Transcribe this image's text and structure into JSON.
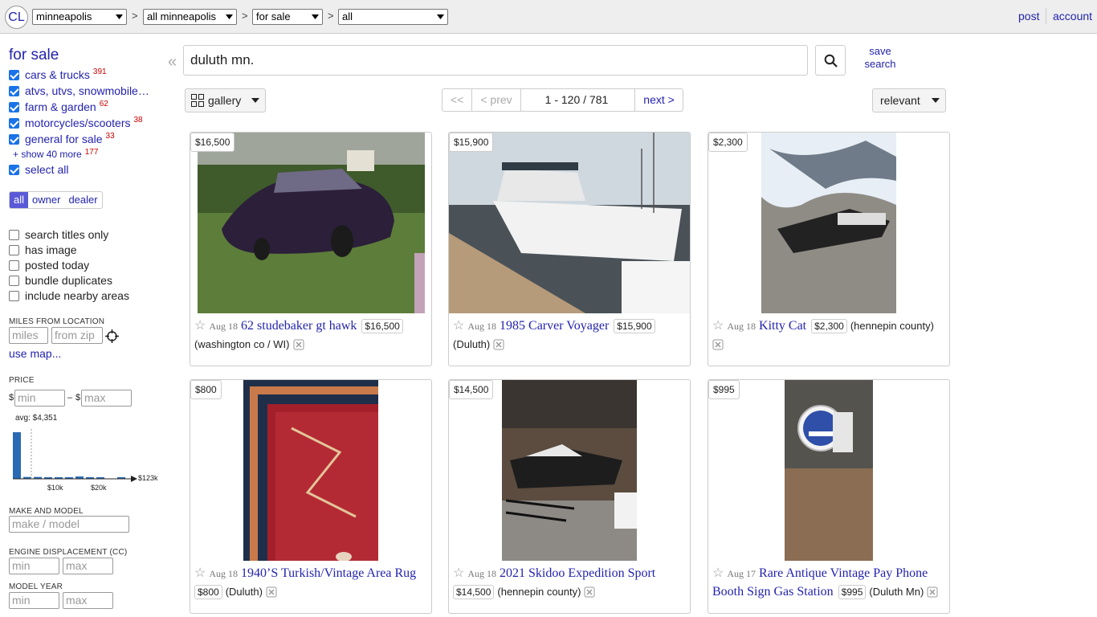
{
  "header": {
    "logo": "CL",
    "area": "minneapolis",
    "subarea": "all minneapolis",
    "category": "for sale",
    "subcategory": "all",
    "post": "post",
    "account": "account"
  },
  "sidebar": {
    "heading": "for sale",
    "categories": [
      {
        "label": "cars & trucks",
        "count": "391"
      },
      {
        "label": "atvs, utvs, snowmobile…",
        "count": ""
      },
      {
        "label": "farm & garden",
        "count": "62"
      },
      {
        "label": "motorcycles/scooters",
        "count": "38"
      },
      {
        "label": "general for sale",
        "count": "33"
      }
    ],
    "show_more": "+ show 40 more",
    "show_more_count": "177",
    "select_all": "select all",
    "seller": [
      "all",
      "owner",
      "dealer"
    ],
    "options": [
      "search titles only",
      "has image",
      "posted today",
      "bundle duplicates",
      "include nearby areas"
    ],
    "miles_label": "MILES FROM LOCATION",
    "miles_placeholder": "miles",
    "zip_placeholder": "from zip",
    "use_map": "use map...",
    "price_label": "PRICE",
    "price_dollar": "$",
    "price_dash": "–",
    "min": "min",
    "max": "max",
    "avg": "avg: $4,351",
    "hist_ticks": [
      "$10k",
      "$20k",
      "$123k"
    ],
    "hist_values": [
      100,
      4,
      4,
      3,
      2,
      2,
      5,
      1,
      1,
      0,
      1
    ],
    "make_label": "MAKE AND MODEL",
    "make_placeholder": "make / model",
    "engine_label": "ENGINE DISPLACEMENT (CC)",
    "year_label": "MODEL YEAR"
  },
  "search": {
    "query": "duluth mn.",
    "save": "save search",
    "view": "gallery",
    "first": "<<",
    "prev": "< prev",
    "range": "1 - 120 / 781",
    "next": "next >",
    "sort": "relevant"
  },
  "listings": [
    {
      "price": "$16,500",
      "date": "Aug 18",
      "title": "62 studebaker gt hawk",
      "hood": "(washington co / WI)"
    },
    {
      "price": "$15,900",
      "date": "Aug 18",
      "title": "1985 Carver Voyager",
      "hood": "(Duluth)"
    },
    {
      "price": "$2,300",
      "date": "Aug 18",
      "title": "Kitty Cat",
      "hood": "(hennepin county)"
    },
    {
      "price": "$800",
      "date": "Aug 18",
      "title": "1940’S Turkish/Vintage Area Rug",
      "hood": "(Duluth)"
    },
    {
      "price": "$14,500",
      "date": "Aug 18",
      "title": "2021 Skidoo Expedition Sport",
      "hood": "(hennepin county)"
    },
    {
      "price": "$995",
      "date": "Aug 17",
      "title": "Rare Antique Vintage Pay Phone Booth Sign Gas Station",
      "hood": "(Duluth Mn)"
    }
  ],
  "colors": {
    "link": "#2323ad",
    "check": "#1a73e8",
    "hist_bar": "#2a6ab4"
  }
}
